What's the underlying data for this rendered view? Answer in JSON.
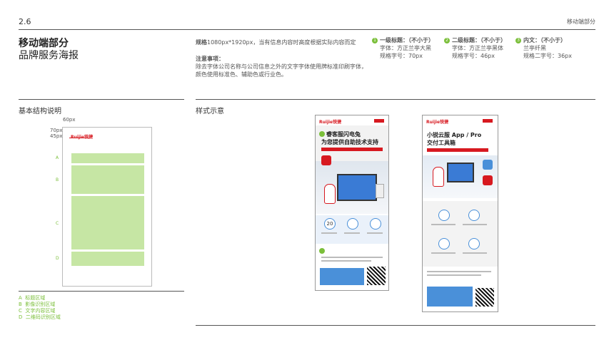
{
  "header": {
    "section_number": "2.6",
    "section_name": "移动端部分"
  },
  "title": {
    "main": "移动端部分",
    "sub": "品牌服务海报"
  },
  "spec": {
    "label": "规格",
    "text": "1080px*1920px，当有信息内容时高度根据实际内容而定"
  },
  "notes": {
    "label": "注意事项：",
    "line1": "除去字体公司名称与公司信息之外的文字字体使用牌标准印刷字体，",
    "line2": "颜色使用标准色、辅助色或行业色。"
  },
  "levels": [
    {
      "num": "1",
      "title": "一级标题：（不小于）",
      "line1": "字体：方正兰亭大黑",
      "line2": "规格字号：70px"
    },
    {
      "num": "2",
      "title": "二级标题：（不小于）",
      "line1": "字体：方正兰亭黑体",
      "line2": "规格字号：46px"
    },
    {
      "num": "3",
      "title": "内文：（不小于）",
      "line1": "兰亭纤黑",
      "line2": "规格二字号：36px"
    }
  ],
  "structure": {
    "heading": "基本结构说明",
    "dim_60": "60px",
    "dim_70": "70px",
    "dim_45": "45px",
    "logo_text": "Ruijie锐捷",
    "zones": [
      "A",
      "B",
      "C",
      "D"
    ],
    "legend": [
      {
        "key": "A",
        "text": "标题区域"
      },
      {
        "key": "B",
        "text": "影像识别区域"
      },
      {
        "key": "C",
        "text": "文字内容区域"
      },
      {
        "key": "D",
        "text": "二维码识别区域"
      }
    ]
  },
  "style_demo": {
    "heading": "样式示意",
    "poster1": {
      "logo": "Ruijie锐捷",
      "title_line1": "睿客服闪电兔",
      "title_line2": "为您提供自助技术支持",
      "stat": "20"
    },
    "poster2": {
      "logo": "Ruijie锐捷",
      "title_line1": "小锐云服 App / Pro",
      "title_line2": "交付工具箱"
    }
  },
  "colors": {
    "accent_green": "#7bbf3a",
    "zone_fill": "#c6e6a4",
    "brand_red": "#d71920"
  }
}
